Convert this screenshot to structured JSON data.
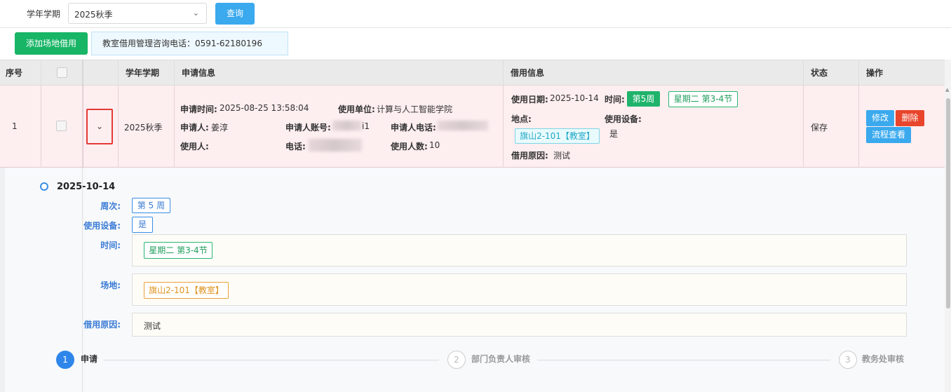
{
  "filter": {
    "term_label": "学年学期",
    "term_value": "2025秋季",
    "query_label": "查询"
  },
  "actions": {
    "add_label": "添加场地借用",
    "phone_notice": "教室借用管理咨询电话：0591-62180196"
  },
  "table": {
    "headers": {
      "seq": "序号",
      "term": "学年学期",
      "apply_info": "申请信息",
      "borrow_info": "借用信息",
      "status": "状态",
      "ops": "操作"
    },
    "row": {
      "seq": "1",
      "term": "2025秋季",
      "expand_icon": "chevron-down-icon",
      "apply_time_label": "申请时间:",
      "apply_time": "2025-08-25 13:58:04",
      "unit_label": "使用单位:",
      "unit": "计算与人工智能学院",
      "applicant_label": "申请人:",
      "applicant": "姜淳",
      "account_label": "申请人账号:",
      "account_visible": "i1",
      "applicant_phone_label": "申请人电话:",
      "user_label": "使用人:",
      "phone_label": "电话:",
      "user_count_label": "使用人数:",
      "user_count": "10",
      "use_date_label": "使用日期:",
      "use_date": "2025-10-14",
      "time_label": "时间:",
      "week_tag": "第5周",
      "slot_tag": "星期二 第3-4节",
      "place_label": "地点:",
      "place_tag": "旗山2-101【教室】",
      "equipment_label": "使用设备:",
      "equipment_value": "是",
      "reason_label": "借用原因:",
      "reason": "测试",
      "status": "保存",
      "edit_label": "修改",
      "delete_label": "删除",
      "flow_label": "流程查看"
    }
  },
  "detail": {
    "date": "2025-10-14",
    "week_label": "周次:",
    "week_value": "第 5 周",
    "equipment_label": "使用设备:",
    "equipment_value": "是",
    "time_label": "时间:",
    "time_value": "星期二 第3-4节",
    "place_label": "场地:",
    "place_value": "旗山2-101【教室】",
    "reason_label": "借用原因:",
    "reason_value": "测试"
  },
  "steps": [
    {
      "num": "1",
      "label": "申请"
    },
    {
      "num": "2",
      "label": "部门负责人审核"
    },
    {
      "num": "3",
      "label": "教务处审核"
    }
  ],
  "colors": {
    "primary_blue": "#3aa9ee",
    "add_green": "#18b566",
    "delete_red": "#e8452c",
    "row_highlight": "#fdeef0"
  }
}
